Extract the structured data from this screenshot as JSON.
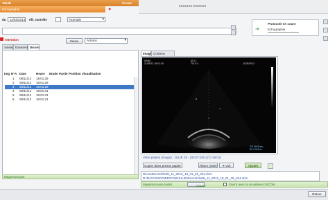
{
  "header": {
    "patient_name": "JULIE",
    "patient_age": "24 ans",
    "exam_label": "Echographie",
    "patient_id": "0025328 0000005"
  },
  "form": {
    "date_label": "du",
    "date_value": "11/03/2014",
    "cote_label": "eff. contrôle",
    "status_value": "Normale"
  },
  "protocol": {
    "title": "Protocole en cours",
    "item": "Echographie"
  },
  "toolbar": {
    "attention_label": "Attention",
    "saisie_label": "Saisie",
    "actions_label": "Actions"
  },
  "tabs_left": [
    "Saisie",
    "Examens",
    "Dicom"
  ],
  "list": {
    "headers": [
      "Img",
      "N°",
      "A",
      "Date",
      "Heure",
      "Etude",
      "Partie",
      "Position",
      "Visualisation"
    ],
    "rows": [
      {
        "n": "1",
        "date": "08/11/12",
        "time": "18:01:29"
      },
      {
        "n": "2",
        "date": "08/11/12",
        "time": "18:01:29"
      },
      {
        "n": "3",
        "date": "08/11/12",
        "time": "18:01:29"
      },
      {
        "n": "4",
        "date": "08/11/12",
        "time": "18:01:31"
      },
      {
        "n": "5",
        "date": "08/11/12",
        "time": "18:01:31"
      },
      {
        "n": "6",
        "date": "08/11/12",
        "time": "18:01:31"
      }
    ],
    "selected_index": 2
  },
  "left_status": "Magnetoscope",
  "viewer_tabs": [
    "Image",
    "Contenu DICOM"
  ],
  "viewer": {
    "overlay_left": "SAML",
    "overlay_left2": "11/08/12 18:01:26",
    "overlay_mid": "M 3.1",
    "overlay_mid2": "TIS 0.4",
    "overlay_right": "11/08/2012",
    "scale_text1": "GP 39/32cm",
    "scale_text2": "E6 2.5/4cm",
    "info_text": "Votre patient (image) : JULIE 25 - (00:07:03/12/11 08/11)"
  },
  "actions": {
    "copy_label": "Copier dans presse papier",
    "album_label": "Album (vide)",
    "voir_label": "Voir",
    "ajouter_label": "Ajouter"
  },
  "paths": [
    "DicomDicomFile08_11_2012_18_01_29_024.dcm",
    "D:\\DATA\\DICOM\\DICOM\\JULIE\\DicomFile08_11_2012_18_01_29_024.dcm"
  ],
  "bottom": {
    "status": "Magnetoscope (vide)",
    "ajouter_label": "Ajouter",
    "checkbox_label": "Ouvrir avec la visualiseur DICOM",
    "retour_label": "Retour"
  },
  "colors": {
    "accent_orange": "#e68a2f",
    "selection_blue": "#3e79c7",
    "status_green": "#c9e4b0"
  }
}
